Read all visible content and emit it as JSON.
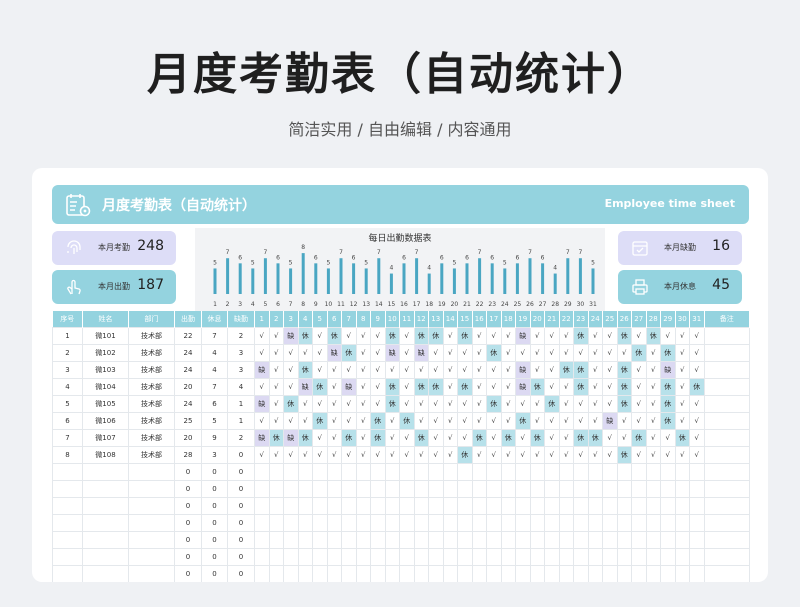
{
  "page": {
    "title": "月度考勤表（自动统计）",
    "subtitle": "简洁实用 / 自由编辑 / 内容通用"
  },
  "header": {
    "title": "月度考勤表（自动统计）",
    "en": "Employee time sheet",
    "icon": "calendar-gear-icon"
  },
  "stats": {
    "month_attendance_label": "本月考勤",
    "month_attendance_value": "248",
    "month_present_label": "本月出勤",
    "month_present_value": "187",
    "month_absent_label": "本月缺勤",
    "month_absent_value": "16",
    "month_rest_label": "本月休息",
    "month_rest_value": "45"
  },
  "colors": {
    "accent": "#94d3df",
    "lavender": "#ddddf7",
    "bar": "#4aa6c2",
    "rest_cell": "#b7e1ea",
    "absent_cell": "#dcd9f2"
  },
  "chart_data": {
    "type": "bar",
    "title": "每日出勤数据表",
    "categories": [
      "1",
      "2",
      "3",
      "4",
      "5",
      "6",
      "7",
      "8",
      "9",
      "10",
      "11",
      "12",
      "13",
      "14",
      "15",
      "16",
      "17",
      "18",
      "19",
      "20",
      "21",
      "22",
      "23",
      "24",
      "25",
      "26",
      "27",
      "28",
      "29",
      "30",
      "31"
    ],
    "values": [
      5,
      7,
      6,
      5,
      7,
      6,
      5,
      8,
      6,
      5,
      7,
      6,
      5,
      7,
      4,
      6,
      7,
      4,
      6,
      5,
      6,
      7,
      6,
      5,
      6,
      7,
      6,
      4,
      7,
      7,
      5
    ],
    "ylim": [
      0,
      9
    ]
  },
  "table": {
    "headers": [
      "序号",
      "姓名",
      "部门",
      "出勤",
      "休息",
      "缺勤",
      "1",
      "2",
      "3",
      "4",
      "5",
      "6",
      "7",
      "8",
      "9",
      "10",
      "11",
      "12",
      "13",
      "14",
      "15",
      "16",
      "17",
      "18",
      "19",
      "20",
      "21",
      "22",
      "23",
      "24",
      "25",
      "26",
      "27",
      "28",
      "29",
      "30",
      "31",
      "备注"
    ],
    "rows": [
      [
        "1",
        "微101",
        "技术部",
        "22",
        "7",
        "2",
        "√",
        "√",
        "缺",
        "休",
        "√",
        "休",
        "√",
        "√",
        "√",
        "休",
        "√",
        "休",
        "休",
        "√",
        "休",
        "√",
        "√",
        "√",
        "缺",
        "√",
        "√",
        "√",
        "休",
        "√",
        "√",
        "休",
        "√",
        "休",
        "√",
        "√",
        "√",
        ""
      ],
      [
        "2",
        "微102",
        "技术部",
        "24",
        "4",
        "3",
        "√",
        "√",
        "√",
        "√",
        "√",
        "缺",
        "休",
        "√",
        "√",
        "缺",
        "√",
        "缺",
        "√",
        "√",
        "√",
        "√",
        "休",
        "√",
        "√",
        "√",
        "√",
        "√",
        "√",
        "√",
        "√",
        "√",
        "休",
        "√",
        "休",
        "√",
        "√",
        ""
      ],
      [
        "3",
        "微103",
        "技术部",
        "24",
        "4",
        "3",
        "缺",
        "√",
        "√",
        "休",
        "√",
        "√",
        "√",
        "√",
        "√",
        "√",
        "√",
        "√",
        "√",
        "√",
        "√",
        "√",
        "√",
        "√",
        "缺",
        "√",
        "√",
        "休",
        "休",
        "√",
        "√",
        "休",
        "√",
        "√",
        "缺",
        "√",
        "√",
        ""
      ],
      [
        "4",
        "微104",
        "技术部",
        "20",
        "7",
        "4",
        "√",
        "√",
        "√",
        "缺",
        "休",
        "√",
        "缺",
        "√",
        "√",
        "休",
        "√",
        "休",
        "休",
        "√",
        "休",
        "√",
        "√",
        "√",
        "缺",
        "休",
        "√",
        "√",
        "休",
        "√",
        "√",
        "休",
        "√",
        "√",
        "休",
        "√",
        "休",
        ""
      ],
      [
        "5",
        "微105",
        "技术部",
        "24",
        "6",
        "1",
        "缺",
        "√",
        "休",
        "√",
        "√",
        "√",
        "√",
        "√",
        "√",
        "休",
        "√",
        "√",
        "√",
        "√",
        "√",
        "√",
        "休",
        "√",
        "√",
        "√",
        "休",
        "√",
        "√",
        "√",
        "√",
        "休",
        "√",
        "√",
        "休",
        "√",
        "√",
        ""
      ],
      [
        "6",
        "微106",
        "技术部",
        "25",
        "5",
        "1",
        "√",
        "√",
        "√",
        "√",
        "休",
        "√",
        "√",
        "√",
        "休",
        "√",
        "休",
        "√",
        "√",
        "√",
        "√",
        "√",
        "√",
        "√",
        "休",
        "√",
        "√",
        "√",
        "√",
        "√",
        "缺",
        "√",
        "√",
        "√",
        "休",
        "√",
        "√",
        ""
      ],
      [
        "7",
        "微107",
        "技术部",
        "20",
        "9",
        "2",
        "缺",
        "休",
        "缺",
        "休",
        "√",
        "√",
        "休",
        "√",
        "休",
        "√",
        "√",
        "休",
        "√",
        "√",
        "√",
        "休",
        "√",
        "休",
        "√",
        "休",
        "√",
        "√",
        "休",
        "休",
        "√",
        "√",
        "休",
        "√",
        "√",
        "休",
        "√",
        ""
      ],
      [
        "8",
        "微108",
        "技术部",
        "28",
        "3",
        "0",
        "√",
        "√",
        "√",
        "√",
        "√",
        "√",
        "√",
        "√",
        "√",
        "√",
        "√",
        "√",
        "√",
        "√",
        "休",
        "√",
        "√",
        "√",
        "√",
        "√",
        "√",
        "√",
        "√",
        "√",
        "√",
        "休",
        "√",
        "√",
        "√",
        "√",
        "√",
        ""
      ],
      [
        "",
        "",
        "",
        "0",
        "0",
        "0",
        "",
        "",
        "",
        "",
        "",
        "",
        "",
        "",
        "",
        "",
        "",
        "",
        "",
        "",
        "",
        "",
        "",
        "",
        "",
        "",
        "",
        "",
        "",
        "",
        "",
        "",
        "",
        "",
        "",
        "",
        "",
        ""
      ],
      [
        "",
        "",
        "",
        "0",
        "0",
        "0",
        "",
        "",
        "",
        "",
        "",
        "",
        "",
        "",
        "",
        "",
        "",
        "",
        "",
        "",
        "",
        "",
        "",
        "",
        "",
        "",
        "",
        "",
        "",
        "",
        "",
        "",
        "",
        "",
        "",
        "",
        "",
        ""
      ],
      [
        "",
        "",
        "",
        "0",
        "0",
        "0",
        "",
        "",
        "",
        "",
        "",
        "",
        "",
        "",
        "",
        "",
        "",
        "",
        "",
        "",
        "",
        "",
        "",
        "",
        "",
        "",
        "",
        "",
        "",
        "",
        "",
        "",
        "",
        "",
        "",
        "",
        "",
        ""
      ],
      [
        "",
        "",
        "",
        "0",
        "0",
        "0",
        "",
        "",
        "",
        "",
        "",
        "",
        "",
        "",
        "",
        "",
        "",
        "",
        "",
        "",
        "",
        "",
        "",
        "",
        "",
        "",
        "",
        "",
        "",
        "",
        "",
        "",
        "",
        "",
        "",
        "",
        "",
        ""
      ],
      [
        "",
        "",
        "",
        "0",
        "0",
        "0",
        "",
        "",
        "",
        "",
        "",
        "",
        "",
        "",
        "",
        "",
        "",
        "",
        "",
        "",
        "",
        "",
        "",
        "",
        "",
        "",
        "",
        "",
        "",
        "",
        "",
        "",
        "",
        "",
        "",
        "",
        "",
        ""
      ],
      [
        "",
        "",
        "",
        "0",
        "0",
        "0",
        "",
        "",
        "",
        "",
        "",
        "",
        "",
        "",
        "",
        "",
        "",
        "",
        "",
        "",
        "",
        "",
        "",
        "",
        "",
        "",
        "",
        "",
        "",
        "",
        "",
        "",
        "",
        "",
        "",
        "",
        "",
        ""
      ],
      [
        "",
        "",
        "",
        "0",
        "0",
        "0",
        "",
        "",
        "",
        "",
        "",
        "",
        "",
        "",
        "",
        "",
        "",
        "",
        "",
        "",
        "",
        "",
        "",
        "",
        "",
        "",
        "",
        "",
        "",
        "",
        "",
        "",
        "",
        "",
        "",
        "",
        "",
        ""
      ]
    ]
  }
}
